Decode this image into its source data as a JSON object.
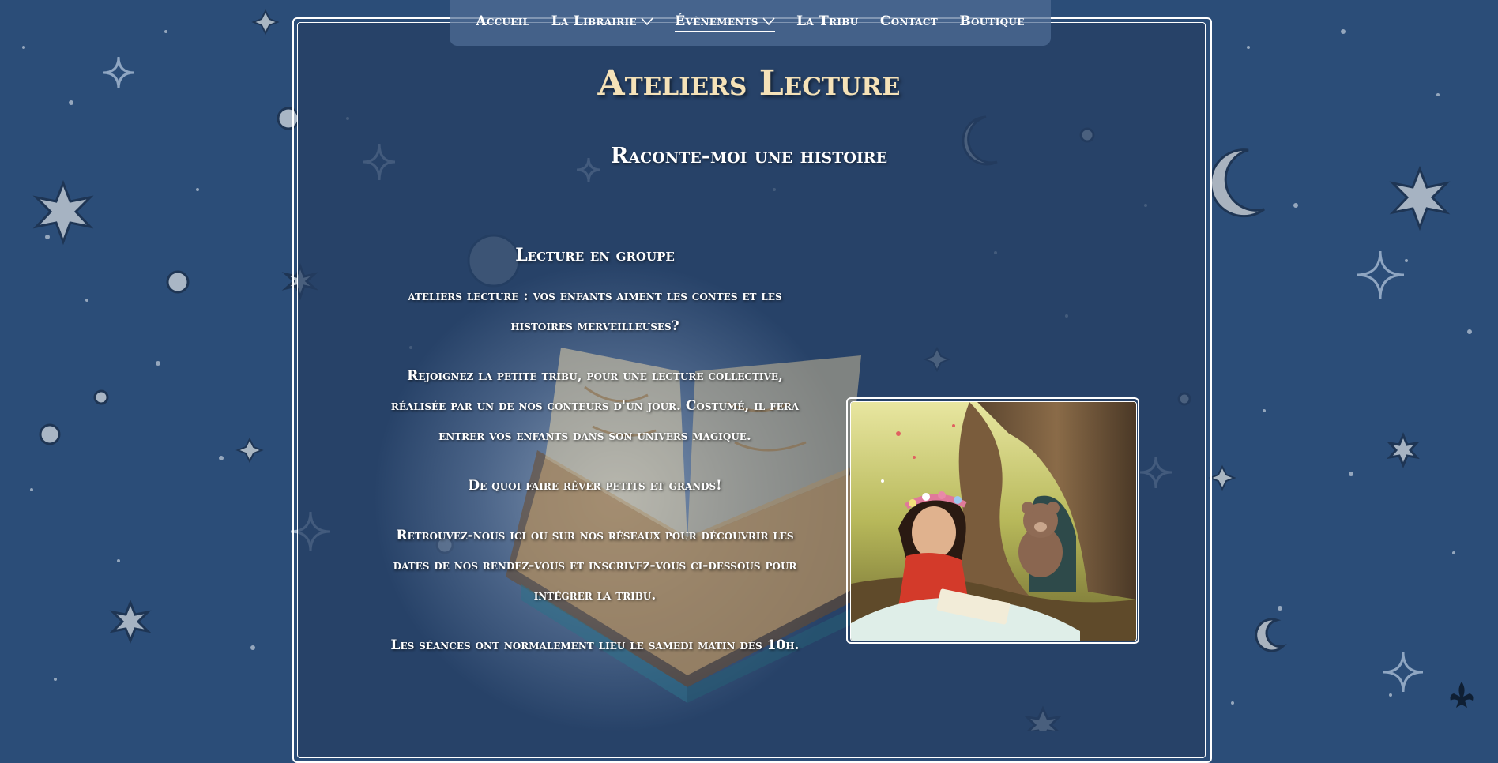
{
  "nav": {
    "items": [
      {
        "label": "Accueil",
        "has_dropdown": false,
        "active": false
      },
      {
        "label": "La Librairie",
        "has_dropdown": true,
        "active": false
      },
      {
        "label": "Évènements",
        "has_dropdown": true,
        "active": true
      },
      {
        "label": "La Tribu",
        "has_dropdown": false,
        "active": false
      },
      {
        "label": "Contact",
        "has_dropdown": false,
        "active": false
      },
      {
        "label": "Boutique",
        "has_dropdown": false,
        "active": false
      }
    ]
  },
  "page": {
    "title": "Ateliers Lecture",
    "subtitle": "Raconte-moi une histoire"
  },
  "section": {
    "heading": "Lecture en groupe",
    "paragraphs": [
      "ateliers lecture : vos enfants aiment les contes et les histoires merveilleuses?",
      "Rejoignez la petite tribu, pour une lecture collective, réalisée par un de nos conteurs d'un jour. Costumé, il fera entrer vos enfants dans son univers magique.",
      "De quoi faire rêver petits et grands!",
      "Retrouvez-nous ici ou sur  nos réseaux pour découvrir les dates de nos rendez-vous et inscrivez-vous ci-dessous pour intégrer la tribu.",
      "Les séances ont normalement lieu le samedi matin dès 10h."
    ]
  },
  "colors": {
    "background": "#2b4d78",
    "title": "#f5e2b8",
    "text": "#ffffff"
  },
  "icons": {
    "dropdown": "chevron-down-icon",
    "corner": "fleur-de-lis-icon"
  }
}
